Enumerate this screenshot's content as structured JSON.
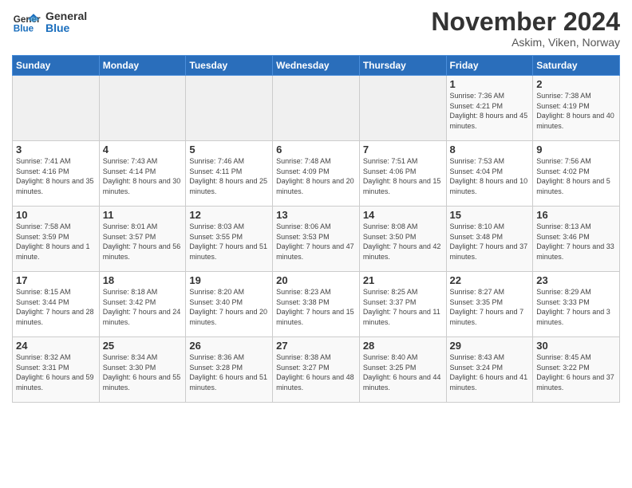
{
  "logo": {
    "line1": "General",
    "line2": "Blue"
  },
  "header": {
    "month": "November 2024",
    "location": "Askim, Viken, Norway"
  },
  "days_of_week": [
    "Sunday",
    "Monday",
    "Tuesday",
    "Wednesday",
    "Thursday",
    "Friday",
    "Saturday"
  ],
  "weeks": [
    [
      {
        "day": "",
        "sunrise": "",
        "sunset": "",
        "daylight": ""
      },
      {
        "day": "",
        "sunrise": "",
        "sunset": "",
        "daylight": ""
      },
      {
        "day": "",
        "sunrise": "",
        "sunset": "",
        "daylight": ""
      },
      {
        "day": "",
        "sunrise": "",
        "sunset": "",
        "daylight": ""
      },
      {
        "day": "",
        "sunrise": "",
        "sunset": "",
        "daylight": ""
      },
      {
        "day": "1",
        "sunrise": "Sunrise: 7:36 AM",
        "sunset": "Sunset: 4:21 PM",
        "daylight": "Daylight: 8 hours and 45 minutes."
      },
      {
        "day": "2",
        "sunrise": "Sunrise: 7:38 AM",
        "sunset": "Sunset: 4:19 PM",
        "daylight": "Daylight: 8 hours and 40 minutes."
      }
    ],
    [
      {
        "day": "3",
        "sunrise": "Sunrise: 7:41 AM",
        "sunset": "Sunset: 4:16 PM",
        "daylight": "Daylight: 8 hours and 35 minutes."
      },
      {
        "day": "4",
        "sunrise": "Sunrise: 7:43 AM",
        "sunset": "Sunset: 4:14 PM",
        "daylight": "Daylight: 8 hours and 30 minutes."
      },
      {
        "day": "5",
        "sunrise": "Sunrise: 7:46 AM",
        "sunset": "Sunset: 4:11 PM",
        "daylight": "Daylight: 8 hours and 25 minutes."
      },
      {
        "day": "6",
        "sunrise": "Sunrise: 7:48 AM",
        "sunset": "Sunset: 4:09 PM",
        "daylight": "Daylight: 8 hours and 20 minutes."
      },
      {
        "day": "7",
        "sunrise": "Sunrise: 7:51 AM",
        "sunset": "Sunset: 4:06 PM",
        "daylight": "Daylight: 8 hours and 15 minutes."
      },
      {
        "day": "8",
        "sunrise": "Sunrise: 7:53 AM",
        "sunset": "Sunset: 4:04 PM",
        "daylight": "Daylight: 8 hours and 10 minutes."
      },
      {
        "day": "9",
        "sunrise": "Sunrise: 7:56 AM",
        "sunset": "Sunset: 4:02 PM",
        "daylight": "Daylight: 8 hours and 5 minutes."
      }
    ],
    [
      {
        "day": "10",
        "sunrise": "Sunrise: 7:58 AM",
        "sunset": "Sunset: 3:59 PM",
        "daylight": "Daylight: 8 hours and 1 minute."
      },
      {
        "day": "11",
        "sunrise": "Sunrise: 8:01 AM",
        "sunset": "Sunset: 3:57 PM",
        "daylight": "Daylight: 7 hours and 56 minutes."
      },
      {
        "day": "12",
        "sunrise": "Sunrise: 8:03 AM",
        "sunset": "Sunset: 3:55 PM",
        "daylight": "Daylight: 7 hours and 51 minutes."
      },
      {
        "day": "13",
        "sunrise": "Sunrise: 8:06 AM",
        "sunset": "Sunset: 3:53 PM",
        "daylight": "Daylight: 7 hours and 47 minutes."
      },
      {
        "day": "14",
        "sunrise": "Sunrise: 8:08 AM",
        "sunset": "Sunset: 3:50 PM",
        "daylight": "Daylight: 7 hours and 42 minutes."
      },
      {
        "day": "15",
        "sunrise": "Sunrise: 8:10 AM",
        "sunset": "Sunset: 3:48 PM",
        "daylight": "Daylight: 7 hours and 37 minutes."
      },
      {
        "day": "16",
        "sunrise": "Sunrise: 8:13 AM",
        "sunset": "Sunset: 3:46 PM",
        "daylight": "Daylight: 7 hours and 33 minutes."
      }
    ],
    [
      {
        "day": "17",
        "sunrise": "Sunrise: 8:15 AM",
        "sunset": "Sunset: 3:44 PM",
        "daylight": "Daylight: 7 hours and 28 minutes."
      },
      {
        "day": "18",
        "sunrise": "Sunrise: 8:18 AM",
        "sunset": "Sunset: 3:42 PM",
        "daylight": "Daylight: 7 hours and 24 minutes."
      },
      {
        "day": "19",
        "sunrise": "Sunrise: 8:20 AM",
        "sunset": "Sunset: 3:40 PM",
        "daylight": "Daylight: 7 hours and 20 minutes."
      },
      {
        "day": "20",
        "sunrise": "Sunrise: 8:23 AM",
        "sunset": "Sunset: 3:38 PM",
        "daylight": "Daylight: 7 hours and 15 minutes."
      },
      {
        "day": "21",
        "sunrise": "Sunrise: 8:25 AM",
        "sunset": "Sunset: 3:37 PM",
        "daylight": "Daylight: 7 hours and 11 minutes."
      },
      {
        "day": "22",
        "sunrise": "Sunrise: 8:27 AM",
        "sunset": "Sunset: 3:35 PM",
        "daylight": "Daylight: 7 hours and 7 minutes."
      },
      {
        "day": "23",
        "sunrise": "Sunrise: 8:29 AM",
        "sunset": "Sunset: 3:33 PM",
        "daylight": "Daylight: 7 hours and 3 minutes."
      }
    ],
    [
      {
        "day": "24",
        "sunrise": "Sunrise: 8:32 AM",
        "sunset": "Sunset: 3:31 PM",
        "daylight": "Daylight: 6 hours and 59 minutes."
      },
      {
        "day": "25",
        "sunrise": "Sunrise: 8:34 AM",
        "sunset": "Sunset: 3:30 PM",
        "daylight": "Daylight: 6 hours and 55 minutes."
      },
      {
        "day": "26",
        "sunrise": "Sunrise: 8:36 AM",
        "sunset": "Sunset: 3:28 PM",
        "daylight": "Daylight: 6 hours and 51 minutes."
      },
      {
        "day": "27",
        "sunrise": "Sunrise: 8:38 AM",
        "sunset": "Sunset: 3:27 PM",
        "daylight": "Daylight: 6 hours and 48 minutes."
      },
      {
        "day": "28",
        "sunrise": "Sunrise: 8:40 AM",
        "sunset": "Sunset: 3:25 PM",
        "daylight": "Daylight: 6 hours and 44 minutes."
      },
      {
        "day": "29",
        "sunrise": "Sunrise: 8:43 AM",
        "sunset": "Sunset: 3:24 PM",
        "daylight": "Daylight: 6 hours and 41 minutes."
      },
      {
        "day": "30",
        "sunrise": "Sunrise: 8:45 AM",
        "sunset": "Sunset: 3:22 PM",
        "daylight": "Daylight: 6 hours and 37 minutes."
      }
    ]
  ]
}
